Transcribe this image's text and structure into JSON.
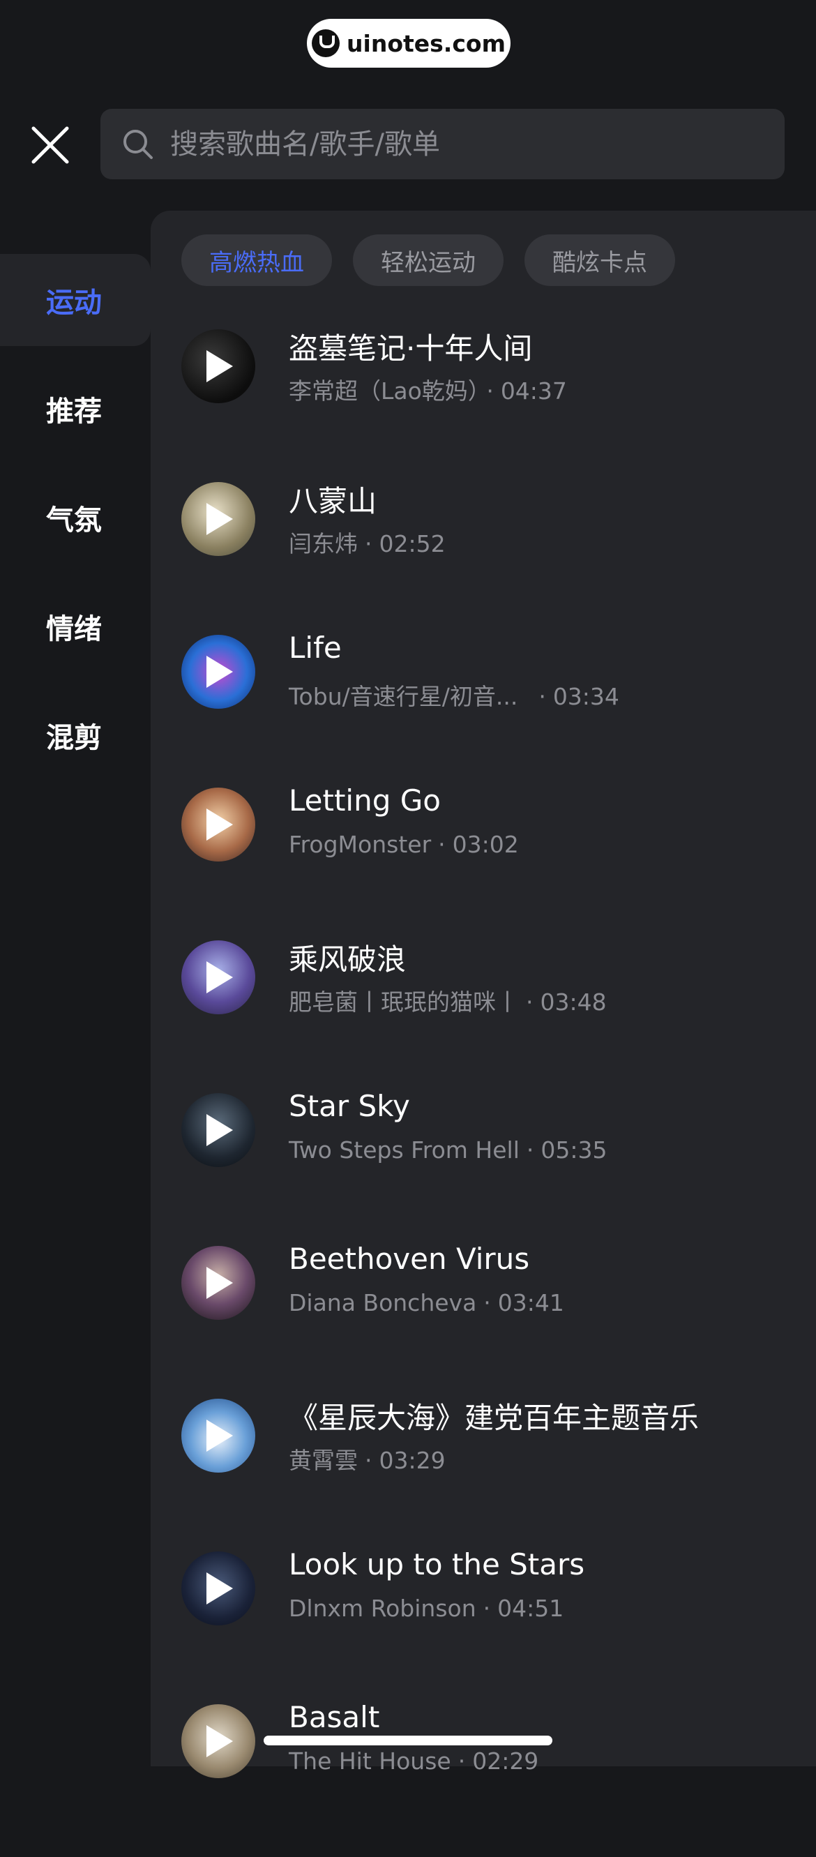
{
  "watermark": {
    "text": "uinotes.com"
  },
  "search": {
    "placeholder": "搜索歌曲名/歌手/歌单"
  },
  "sidebar": {
    "items": [
      {
        "label": "运动",
        "active": true
      },
      {
        "label": "推荐",
        "active": false
      },
      {
        "label": "气氛",
        "active": false
      },
      {
        "label": "情绪",
        "active": false
      },
      {
        "label": "混剪",
        "active": false
      }
    ]
  },
  "chips": [
    {
      "label": "高燃热血",
      "active": true
    },
    {
      "label": "轻松运动",
      "active": false
    },
    {
      "label": "酷炫卡点",
      "active": false
    }
  ],
  "songs": [
    {
      "title": "盗墓笔记·十年人间",
      "artist": "李常超（Lao乾妈）",
      "duration": "04:37"
    },
    {
      "title": "八蒙山",
      "artist": "闫东炜",
      "duration": "02:52"
    },
    {
      "title": "Life",
      "artist": "Tobu/音速行星/初音...",
      "duration": "03:34"
    },
    {
      "title": "Letting Go",
      "artist": "FrogMonster",
      "duration": "03:02"
    },
    {
      "title": "乘风破浪",
      "artist": "肥皂菌丨珉珉的猫咪丨",
      "duration": "03:48"
    },
    {
      "title": "Star Sky",
      "artist": "Two Steps From Hell",
      "duration": "05:35"
    },
    {
      "title": "Beethoven Virus",
      "artist": "Diana Boncheva",
      "duration": "03:41"
    },
    {
      "title": "《星辰大海》建党百年主题音乐",
      "artist": "黄霄雲",
      "duration": "03:29"
    },
    {
      "title": "Look up to the Stars",
      "artist": "Dlnxm Robinson",
      "duration": "04:51"
    },
    {
      "title": "Basalt",
      "artist": "The Hit House",
      "duration": "02:29"
    }
  ],
  "colors": {
    "accent": "#4a6cf7",
    "background": "#17181b",
    "panel": "#242529"
  }
}
